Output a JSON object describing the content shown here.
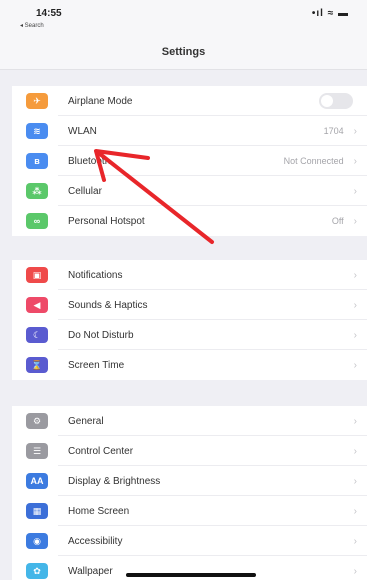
{
  "status_bar": {
    "time": "14:55",
    "back_label": "◂ Search",
    "indicators": "•ıl ≈ ▬"
  },
  "nav": {
    "title": "Settings"
  },
  "group1": [
    {
      "label": "Airplane Mode",
      "icon": "airplane-icon",
      "color": "#f59b3c",
      "glyph": "✈",
      "accessory": "toggle",
      "toggle_on": false
    },
    {
      "label": "WLAN",
      "icon": "wifi-icon",
      "color": "#4a8cf0",
      "glyph": "≋",
      "value": "1704",
      "accessory": "chevron"
    },
    {
      "label": "Bluetooth",
      "icon": "bluetooth-icon",
      "color": "#4a8cf0",
      "glyph": "ʙ",
      "value": "Not Connected",
      "accessory": "chevron"
    },
    {
      "label": "Cellular",
      "icon": "cellular-icon",
      "color": "#5bc86a",
      "glyph": "⁂",
      "accessory": "chevron"
    },
    {
      "label": "Personal Hotspot",
      "icon": "hotspot-icon",
      "color": "#5bc86a",
      "glyph": "∞",
      "value": "Off",
      "accessory": "chevron"
    }
  ],
  "group2": [
    {
      "label": "Notifications",
      "icon": "notifications-icon",
      "color": "#ef4a4a",
      "glyph": "▣"
    },
    {
      "label": "Sounds & Haptics",
      "icon": "sounds-icon",
      "color": "#ee4a68",
      "glyph": "◀"
    },
    {
      "label": "Do Not Disturb",
      "icon": "moon-icon",
      "color": "#5a5bd0",
      "glyph": "☾"
    },
    {
      "label": "Screen Time",
      "icon": "hourglass-icon",
      "color": "#5a5bd0",
      "glyph": "⌛"
    }
  ],
  "group3": [
    {
      "label": "General",
      "icon": "gear-icon",
      "color": "#9a9aa0",
      "glyph": "⚙"
    },
    {
      "label": "Control Center",
      "icon": "control-center-icon",
      "color": "#9a9aa0",
      "glyph": "☰"
    },
    {
      "label": "Display & Brightness",
      "icon": "display-icon",
      "color": "#3c7be0",
      "glyph": "AA"
    },
    {
      "label": "Home Screen",
      "icon": "home-screen-icon",
      "color": "#3c6fd8",
      "glyph": "▦"
    },
    {
      "label": "Accessibility",
      "icon": "accessibility-icon",
      "color": "#3c7be0",
      "glyph": "◉"
    },
    {
      "label": "Wallpaper",
      "icon": "wallpaper-icon",
      "color": "#44b6e8",
      "glyph": "✿"
    }
  ],
  "chevron": "›",
  "annotation": {
    "color": "#e8262a"
  }
}
